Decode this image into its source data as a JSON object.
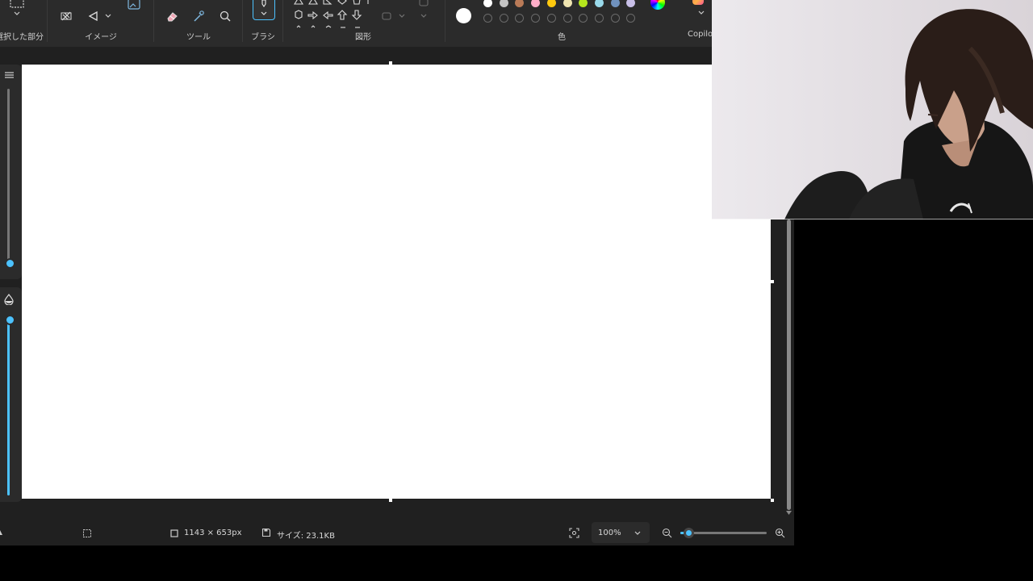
{
  "ribbon": {
    "groups": {
      "selection": "選択した部分",
      "image": "イメージ",
      "tools": "ツール",
      "brush": "ブラシ",
      "shapes": "図形",
      "colors": "色",
      "copilot": "Copilot"
    },
    "color_swatches": [
      "#ffffff",
      "#c3c3c3",
      "#b97a57",
      "#ffaec9",
      "#ffc90e",
      "#efe4b0",
      "#b5e61d",
      "#99d9ea",
      "#7092be",
      "#c8bfe7"
    ],
    "current_color": "#ffffff"
  },
  "statusbar": {
    "canvas_size": "1143 × 653px",
    "file_size": "サイズ: 23.1KB",
    "zoom_level": "100%",
    "zoom_slider_value": 0.1
  },
  "colors": {
    "accent": "#4cc2ff",
    "ribbon_bg": "#2b2b2b",
    "app_bg": "#202020"
  }
}
